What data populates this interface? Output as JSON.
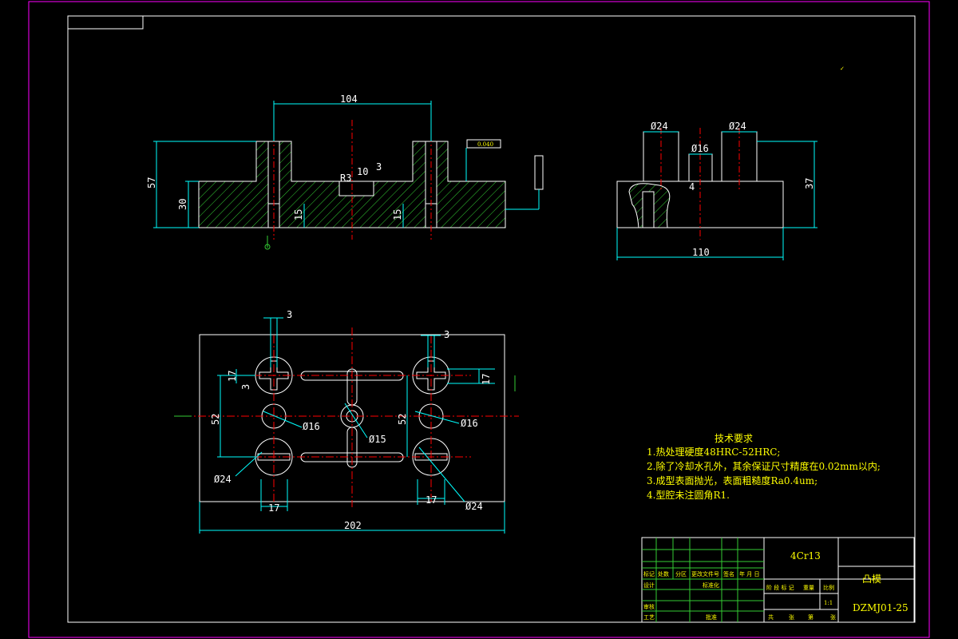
{
  "drawing": {
    "material": "4Cr13",
    "part_name": "凸模",
    "drawing_number": "DZMJ01-25",
    "scale": "1:1"
  },
  "front_view": {
    "dims": {
      "width_top": "104",
      "height_total": "57",
      "height_base": "30",
      "depth_left": "15",
      "depth_right": "15",
      "r": "R3",
      "w10": "10",
      "w3": "3"
    },
    "tol_frame": "0.040"
  },
  "side_view": {
    "dims": {
      "d_left": "Ø24",
      "d_right": "Ø24",
      "d_center": "Ø16",
      "height": "37",
      "width": "110",
      "small": "4"
    }
  },
  "plan_view": {
    "dims": {
      "top_left_3": "3",
      "top_right_3": "3",
      "left_17": "17",
      "left_3": "3",
      "right_17": "17",
      "left_52": "52",
      "right_52": "52",
      "d16_left": "Ø16",
      "d16_right": "Ø16",
      "d15": "Ø15",
      "d24_left": "Ø24",
      "d24_right": "Ø24",
      "bottom_17_left": "17",
      "bottom_17_right": "17",
      "overall": "202"
    }
  },
  "tech_requirements": {
    "title": "技术要求",
    "items": [
      "1.热处理硬度48HRC-52HRC;",
      "2.除了冷却水孔外，其余保证尺寸精度在0.02mm以内;",
      "3.成型表面抛光，表面粗糙度Ra0.4um;",
      "4.型腔未注圆角R1."
    ]
  },
  "title_block": {
    "row_labels": [
      "标记",
      "处数",
      "分区",
      "更改文件号",
      "签名",
      "年 月 日"
    ],
    "left_labels": [
      "设计",
      "审核",
      "工艺"
    ],
    "mid_labels": [
      "标准化",
      "批准"
    ],
    "stage_labels": [
      "阶 段 标 记",
      "重量",
      "比例"
    ],
    "bottom_row": [
      "共",
      "张",
      "第",
      "张"
    ]
  },
  "colors": {
    "border": "#ff00ff",
    "outline": "#ffffff",
    "dim": "#00ffff",
    "hatch": "#33cc33",
    "center": "#ff0000",
    "text": "#ffff00"
  }
}
